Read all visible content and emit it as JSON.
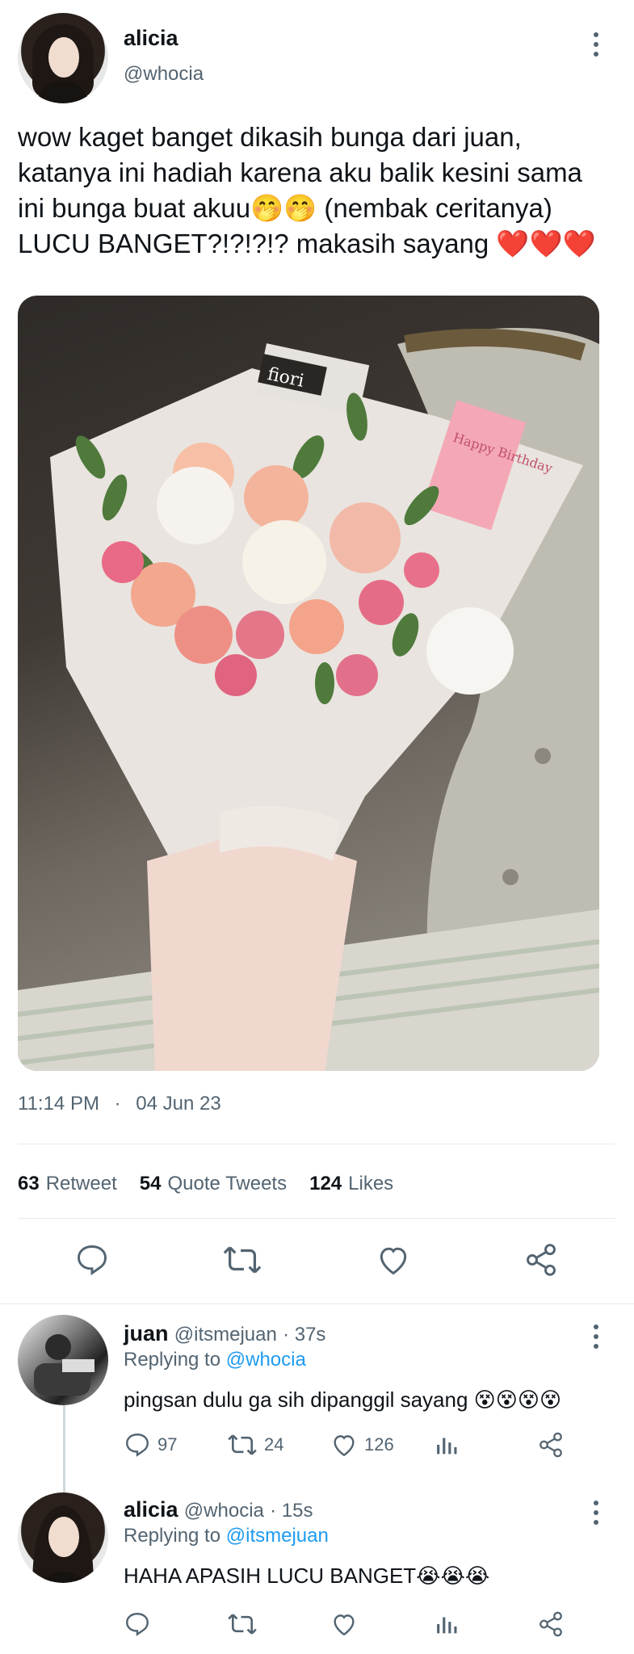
{
  "tweet": {
    "author": {
      "name": "alicia",
      "handle": "@whocia"
    },
    "text": "wow kaget banget dikasih bunga dari juan,\nkatanya ini hadiah karena aku balik kesini sama\nini bunga buat akuu🤭🤭 (nembak ceritanya)\nLUCU BANGET?!?!?!? makasih sayang ❤️❤️❤️",
    "time": "11:14 PM",
    "date": "04 Jun 23",
    "image_text": {
      "brand": "fiori",
      "card": "Happy Birthday"
    },
    "stats": {
      "retweets": "63",
      "retweets_label": "Retweet",
      "quotes": "54",
      "quotes_label": "Quote Tweets",
      "likes": "124",
      "likes_label": "Likes"
    }
  },
  "replies": [
    {
      "name": "juan",
      "handle": "@itsmejuan",
      "time": "· 37s",
      "replying_label": "Replying to",
      "replying_to": "@whocia",
      "text": "pingsan dulu ga sih dipanggil sayang 😵😵😵😵",
      "replies": "97",
      "retweets": "24",
      "likes": "126"
    },
    {
      "name": "alicia",
      "handle": "@whocia",
      "time": "· 15s",
      "replying_label": "Replying to",
      "replying_to": "@itsmejuan",
      "text": "HAHA APASIH LUCU BANGET😭😭😭",
      "replies": "",
      "retweets": "",
      "likes": ""
    }
  ],
  "colors": {
    "link": "#1d9bf0",
    "secondary": "#536471",
    "heart": "#e0245e"
  }
}
